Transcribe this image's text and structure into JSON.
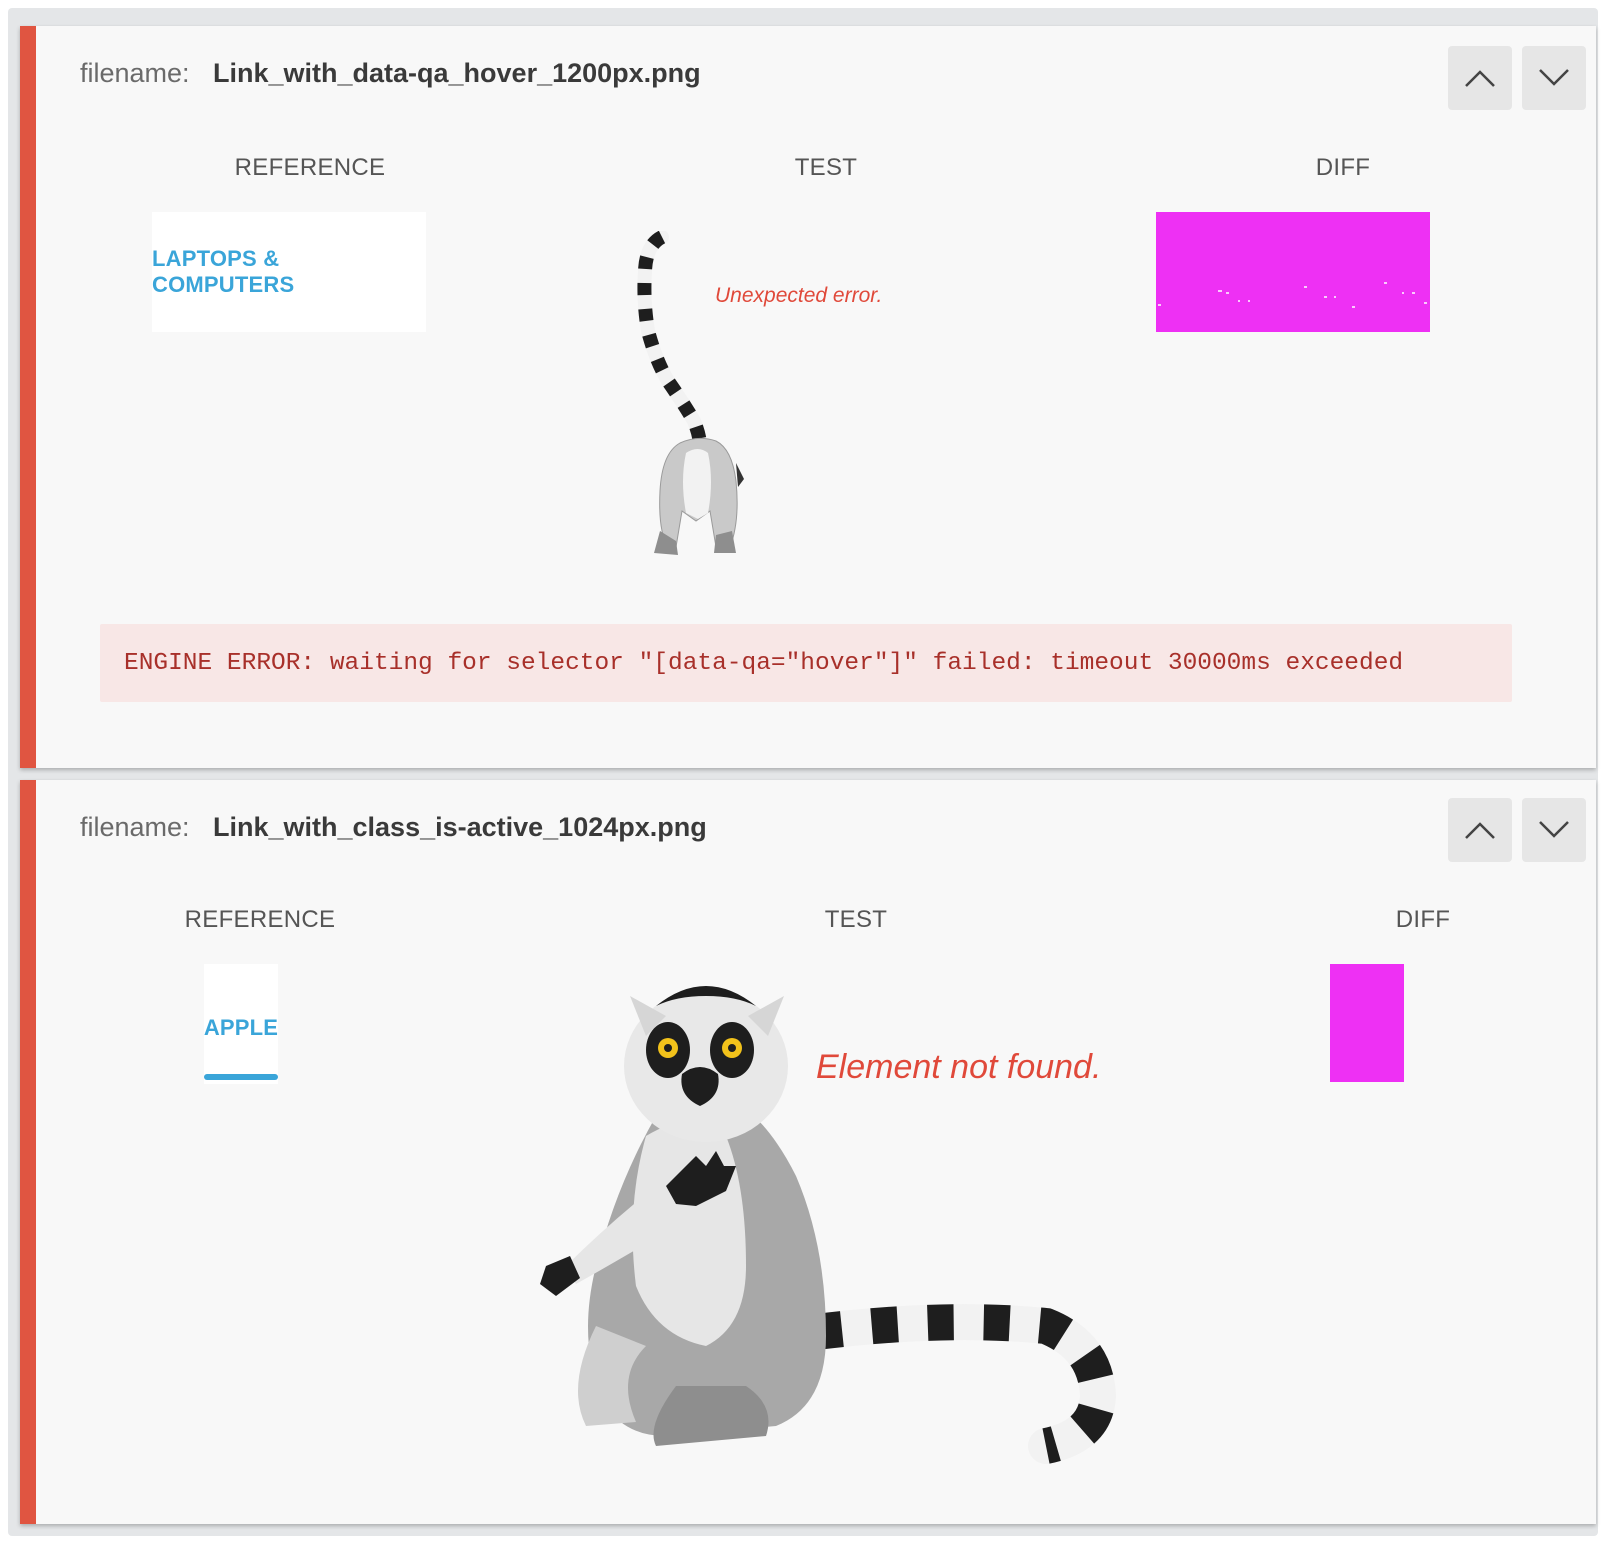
{
  "colors": {
    "accent": "#e05541",
    "diff_fill": "#ee30f4",
    "link_blue": "#3aa5d9",
    "error_red": "#e0493a"
  },
  "cards": [
    {
      "filename_label": "filename:",
      "filename": "Link_with_data-qa_hover_1200px.png",
      "columns": {
        "reference": "REFERENCE",
        "test": "TEST",
        "diff": "DIFF"
      },
      "reference_text": "LAPTOPS & COMPUTERS",
      "test_message": "Unexpected error.",
      "engine_error": "ENGINE ERROR: waiting for selector \"[data-qa=\"hover\"]\" failed: timeout 30000ms exceeded",
      "icons": {
        "up": "chevron-up-icon",
        "down": "chevron-down-icon",
        "test_image": "lemur-back-illustration"
      }
    },
    {
      "filename_label": "filename:",
      "filename": "Link_with_class_is-active_1024px.png",
      "columns": {
        "reference": "REFERENCE",
        "test": "TEST",
        "diff": "DIFF"
      },
      "reference_text": "APPLE",
      "test_message": "Element not found.",
      "icons": {
        "up": "chevron-up-icon",
        "down": "chevron-down-icon",
        "test_image": "lemur-sitting-illustration"
      }
    }
  ]
}
